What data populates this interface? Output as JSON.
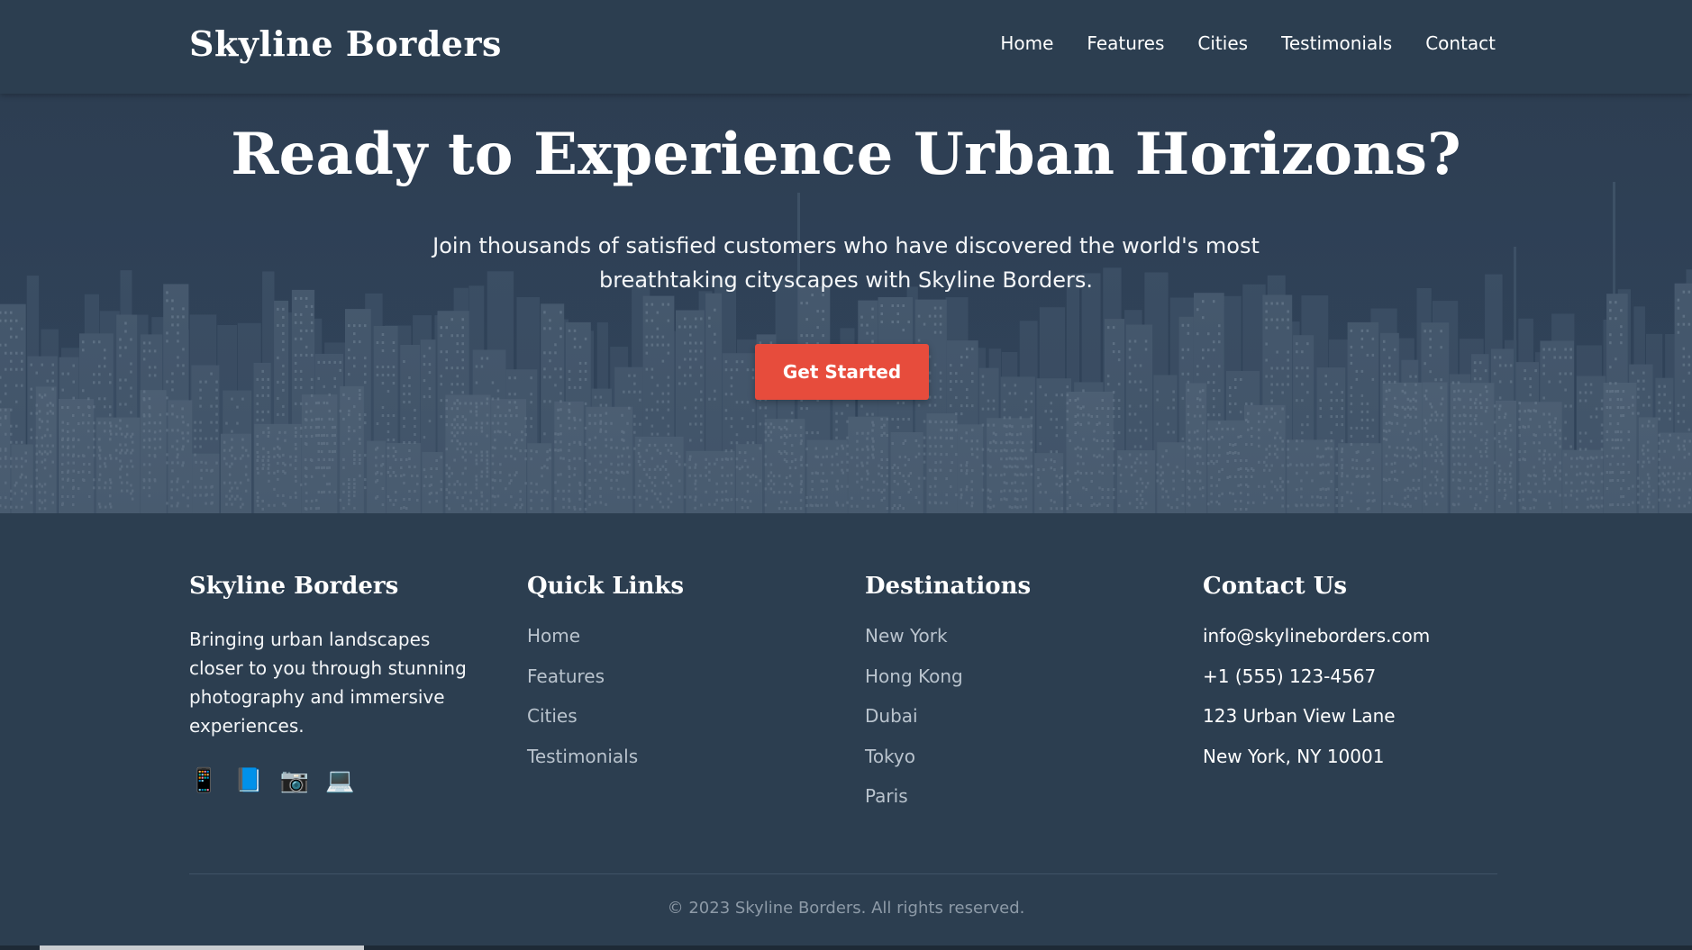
{
  "header": {
    "logo": "Skyline Borders",
    "nav": [
      "Home",
      "Features",
      "Cities",
      "Testimonials",
      "Contact"
    ]
  },
  "hero": {
    "title": "Ready to Experience Urban Horizons?",
    "subtitle": "Join thousands of satisfied customers who have discovered the world's most breathtaking cityscapes with Skyline Borders.",
    "cta_label": "Get Started"
  },
  "footer": {
    "brand": {
      "heading": "Skyline Borders",
      "description": "Bringing urban landscapes closer to you through stunning photography and immersive experiences.",
      "social_icons": [
        "📱",
        "📘",
        "📷",
        "💻"
      ]
    },
    "quick_links": {
      "heading": "Quick Links",
      "items": [
        "Home",
        "Features",
        "Cities",
        "Testimonials"
      ]
    },
    "destinations": {
      "heading": "Destinations",
      "items": [
        "New York",
        "Hong Kong",
        "Dubai",
        "Tokyo",
        "Paris"
      ]
    },
    "contact": {
      "heading": "Contact Us",
      "items": [
        "info@skylineborders.com",
        "+1 (555) 123-4567",
        "123 Urban View Lane",
        "New York, NY 10001"
      ]
    },
    "copyright": "© 2023 Skyline Borders. All rights reserved."
  },
  "colors": {
    "background": "#2c3e50",
    "accent": "#e74c3c",
    "link_muted": "#b9c3cd"
  }
}
